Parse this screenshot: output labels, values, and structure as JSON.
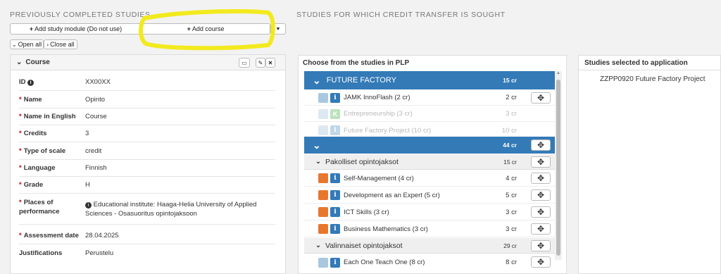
{
  "left": {
    "section_title": "PREVIOUSLY COMPLETED STUDIES",
    "add_module_label": "Add study module (Do not use)",
    "add_course_label": "Add course",
    "open_all_label": "Open all",
    "close_all_label": "Close all",
    "panel_title": "Course",
    "fields": {
      "id_label": "ID",
      "id_value": "XX00XX",
      "name_label": "Name",
      "name_value": "Opinto",
      "name_en_label": "Name in English",
      "name_en_value": "Course",
      "credits_label": "Credits",
      "credits_value": "3",
      "scale_label": "Type of scale",
      "scale_value": "credit",
      "language_label": "Language",
      "language_value": "Finnish",
      "grade_label": "Grade",
      "grade_value": "H",
      "places_label": "Places of performance",
      "places_value": "Educational institute: Haaga-Helia University of Applied Sciences - Osasuoritus opintojaksoon",
      "assessment_label": "Assessment date",
      "assessment_value": "28.04.2025",
      "justifications_label": "Justifications",
      "justifications_value": "Perustelu"
    }
  },
  "middle": {
    "section_title": "STUDIES FOR WHICH CREDIT TRANSFER IS SOUGHT",
    "panel_title": "Choose from the studies in PLP",
    "future_factory": {
      "title": "FUTURE FACTORY",
      "cr": "15 cr"
    },
    "ff_items": [
      {
        "name": "JAMK InnoFlash (2 cr)",
        "cr": "2 cr",
        "badge": "i"
      },
      {
        "name": "Entrepreneurship (3 cr)",
        "cr": "3 cr",
        "badge": "K"
      },
      {
        "name": "Future Factory Project (10 cr)",
        "cr": "10 cr",
        "badge": "i"
      }
    ],
    "second_group": {
      "title": "",
      "cr": "44 cr"
    },
    "pakolliset": {
      "title": "Pakolliset opintojaksot",
      "cr": "15 cr"
    },
    "pak_items": [
      {
        "name": "Self-Management (4 cr)",
        "cr": "4 cr",
        "badge": "i"
      },
      {
        "name": "Development as an Expert (5 cr)",
        "cr": "5 cr",
        "badge": "i"
      },
      {
        "name": "ICT Skills (3 cr)",
        "cr": "3 cr",
        "badge": "i"
      },
      {
        "name": "Business Mathematics (3 cr)",
        "cr": "3 cr",
        "badge": "i"
      }
    ],
    "valinnaiset": {
      "title": "Valinnaiset opintojaksot",
      "cr": "29 cr"
    },
    "val_items": [
      {
        "name": "Each One Teach One (8 cr)",
        "cr": "8 cr",
        "badge": "i"
      }
    ]
  },
  "right": {
    "panel_title": "Studies selected to application",
    "items": [
      "ZZPP0920 Future Factory Project"
    ]
  },
  "colors": {
    "accent": "#337ab7",
    "orange": "#e8772e",
    "light_blue_sq": "#a8c8e0",
    "highlight": "#f2ea1e"
  }
}
